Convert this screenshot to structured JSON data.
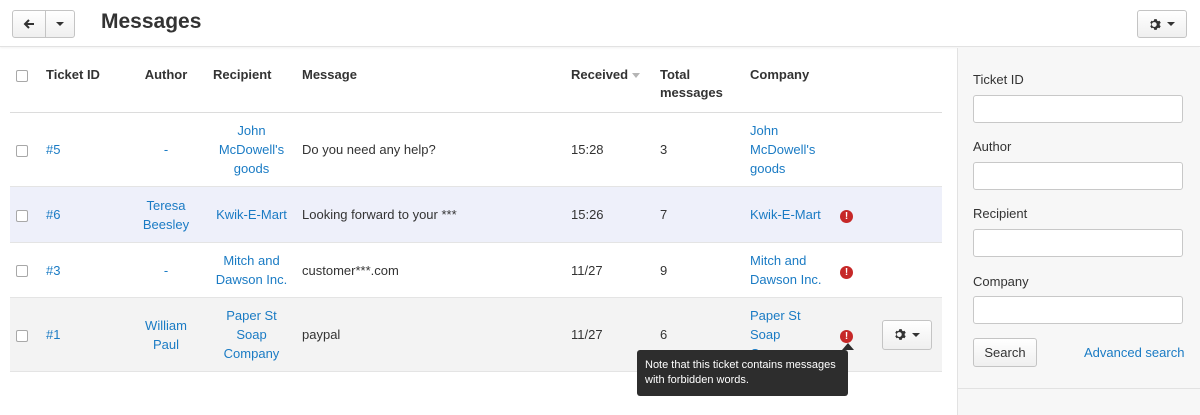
{
  "header": {
    "title": "Messages"
  },
  "columns": {
    "ticket_id": "Ticket ID",
    "author": "Author",
    "recipient": "Recipient",
    "message": "Message",
    "received": "Received",
    "total_messages": "Total messages",
    "company": "Company"
  },
  "rows": [
    {
      "ticket": "#5",
      "author": "-",
      "recipient": "John McDowell's goods",
      "message": "Do you need any help?",
      "received": "15:28",
      "total": "3",
      "company": "John McDowell's goods",
      "alert": false
    },
    {
      "ticket": "#6",
      "author": "Teresa Beesley",
      "recipient": "Kwik-E-Mart",
      "message": "Looking forward to your ***",
      "received": "15:26",
      "total": "7",
      "company": "Kwik-E-Mart",
      "alert": true
    },
    {
      "ticket": "#3",
      "author": "-",
      "recipient": "Mitch and Dawson Inc.",
      "message": "customer***.com",
      "received": "11/27",
      "total": "9",
      "company": "Mitch and Dawson Inc.",
      "alert": true
    },
    {
      "ticket": "#1",
      "author": "William Paul",
      "recipient": "Paper St Soap Company",
      "message": "paypal",
      "received": "11/27",
      "total": "6",
      "company": "Paper St Soap Company",
      "alert": true
    }
  ],
  "alert_glyph": "!",
  "tooltip": "Note that this ticket contains messages with forbidden words.",
  "sidebar": {
    "ticket_id_label": "Ticket ID",
    "author_label": "Author",
    "recipient_label": "Recipient",
    "company_label": "Company",
    "search_label": "Search",
    "advanced_search": "Advanced search"
  },
  "colors": {
    "link": "#1a7bc4",
    "alert": "#c62828",
    "highlight_row": "#eef0fa",
    "hover_row": "#f3f3f3",
    "tooltip_bg": "#2d2d2d"
  },
  "icons": {
    "back": "arrow-left-icon",
    "gear": "gear-icon",
    "alert": "exclamation-circle-icon",
    "sort": "sort-caret-icon"
  }
}
